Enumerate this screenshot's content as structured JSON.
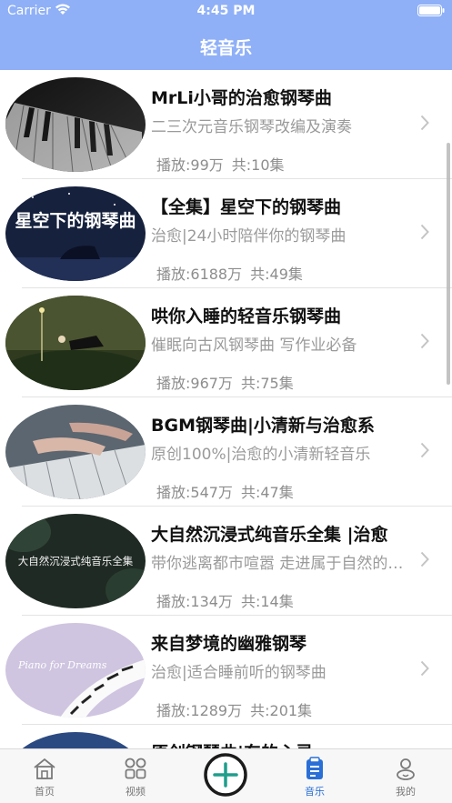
{
  "status_bar": {
    "carrier": "Carrier",
    "time": "4:45 PM"
  },
  "nav": {
    "title": "轻音乐"
  },
  "colors": {
    "nav_bar": "#8fb0f7",
    "tab_active": "#2a6fd6",
    "add_button": "#1f9e8c"
  },
  "list": [
    {
      "title": "MrLi小哥的治愈钢琴曲",
      "subtitle": "二三次元音乐钢琴改编及演奏",
      "plays": "播放:99万",
      "count": "共:10集",
      "thumb_text": ""
    },
    {
      "title": "【全集】星空下的钢琴曲",
      "subtitle": "治愈|24小时陪伴你的钢琴曲",
      "plays": "播放:6188万",
      "count": "共:49集",
      "thumb_text": "星空下的钢琴曲"
    },
    {
      "title": "哄你入睡的轻音乐钢琴曲",
      "subtitle": "催眠向古风钢琴曲 写作业必备",
      "plays": "播放:967万",
      "count": "共:75集",
      "thumb_text": ""
    },
    {
      "title": "BGM钢琴曲|小清新与治愈系",
      "subtitle": "原创100%|治愈的小清新轻音乐",
      "plays": "播放:547万",
      "count": "共:47集",
      "thumb_text": ""
    },
    {
      "title": "大自然沉浸式纯音乐全集 |治愈",
      "subtitle": "带你逃离都市喧嚣 走进属于自然的世界",
      "plays": "播放:134万",
      "count": "共:14集",
      "thumb_text": "大自然沉浸式纯音乐全集"
    },
    {
      "title": "来自梦境的幽雅钢琴",
      "subtitle": "治愈|适合睡前听的钢琴曲",
      "plays": "播放:1289万",
      "count": "共:201集",
      "thumb_text": "Piano for Dreams"
    },
    {
      "title": "原创钢琴曲|东的心灵",
      "subtitle": "",
      "plays": "",
      "count": "",
      "thumb_text": ""
    }
  ],
  "tabbar": {
    "home": "首页",
    "video": "视频",
    "music": "音乐",
    "mine": "我的",
    "active": "音乐"
  }
}
